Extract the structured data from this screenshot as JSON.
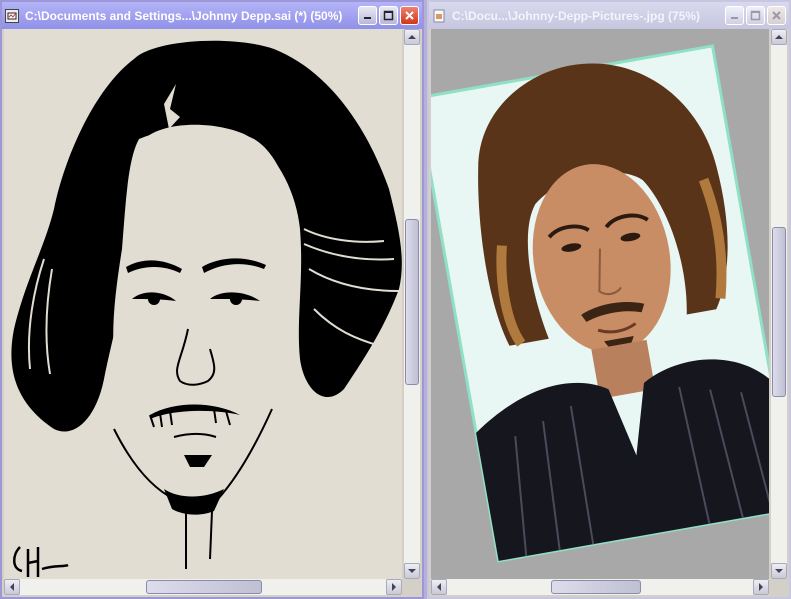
{
  "windows": [
    {
      "title": "C:\\Documents and Settings...\\Johnny Depp.sai (*) (50%)",
      "content": "black-and-white caricature drawing",
      "signature": "signature"
    },
    {
      "title": "C:\\Docu...\\Johnny-Depp-Pictures-.jpg (75%)",
      "content": "rotated color photograph"
    }
  ],
  "icons": {
    "app": "sai-app-icon",
    "image": "image-file-icon",
    "minimize": "minimize-icon",
    "maximize": "maximize-icon",
    "close": "close-icon"
  },
  "colors": {
    "active_title": "#9c98d8",
    "inactive_title": "#c8c6e0",
    "close_active": "#d03818",
    "canvas_paper": "#e2ddd3",
    "photo_background": "#a8a8a8"
  }
}
